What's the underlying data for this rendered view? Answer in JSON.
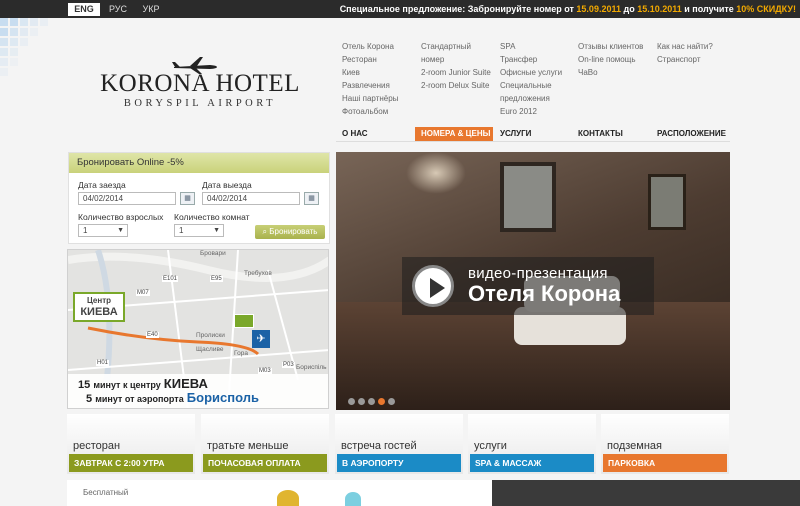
{
  "topbar": {
    "languages": [
      {
        "label": "ENG",
        "active": true
      },
      {
        "label": "РУС",
        "active": false
      },
      {
        "label": "УКР",
        "active": false
      }
    ],
    "offer": {
      "prefix": "Специальное предложение: Забронируйте номер от ",
      "date_from": "15.09.2011",
      "mid": " до ",
      "date_to": "15.10.2011",
      "suffix": " и получите ",
      "discount": "10% СКИДКУ!"
    }
  },
  "logo": {
    "title": "KORONA HOTEL",
    "subtitle": "BORYSPIL AIRPORT",
    "icon": "airplane-icon"
  },
  "nav": {
    "columns": [
      {
        "head": "О НАС",
        "active": false,
        "links": [
          "Отель Корона",
          "Ресторан",
          "Киев",
          "Развлечения",
          "Наші партнёры",
          "Фотоальбом"
        ]
      },
      {
        "head": "НОМЕРА & ЦЕНЫ",
        "active": true,
        "links": [
          "Стандартный номер",
          "2-room Junior Suite",
          "2-room Delux Suite"
        ]
      },
      {
        "head": "УСЛУГИ",
        "active": false,
        "links": [
          "SPA",
          "Трансфер",
          "Офисные услуги",
          "Специальные предложения",
          "Euro 2012"
        ]
      },
      {
        "head": "КОНТАКТЫ",
        "active": false,
        "links": [
          "Отзывы клиентов",
          "On-line помощь",
          "ЧаВо"
        ]
      },
      {
        "head": "РАСПОЛОЖЕНИЕ",
        "active": false,
        "links": [
          "Как нас найти?",
          "Странспорт"
        ]
      }
    ]
  },
  "booking": {
    "title": "Бронировать Online -5%",
    "checkin_label": "Дата заезда",
    "checkin_value": "04/02/2014",
    "checkout_label": "Дата выезда",
    "checkout_value": "04/02/2014",
    "adults_label": "Количество взрослых",
    "adults_value": "1",
    "rooms_label": "Количество комнат",
    "rooms_value": "1",
    "button": "Бронировать"
  },
  "map": {
    "center_label_1": "Центр",
    "center_label_2": "КИЕВА",
    "caption1_num": "15",
    "caption1_text": "минут к центру",
    "caption1_place": "КИЕВА",
    "caption2_num": "5",
    "caption2_text": "минут от аэропорта",
    "caption2_place": "Борисполь",
    "places": [
      "Бровари",
      "Требухов",
      "Пролиски",
      "Щасливе",
      "Гора",
      "Бориспіль"
    ],
    "roads": [
      "E101",
      "E95",
      "H01",
      "M07",
      "M03",
      "E40",
      "P03"
    ]
  },
  "video": {
    "line1": "видео-презентация",
    "line2": "Отеля Корона",
    "slides": 5,
    "active_slide": 4
  },
  "tiles": [
    {
      "title": "ресторан",
      "bar": "ЗАВТРАК С 2:00 УТРА",
      "color": "#8b9a1e"
    },
    {
      "title": "тратьте меньше",
      "bar": "ПОЧАСОВАЯ ОПЛАТА",
      "color": "#8b9a1e"
    },
    {
      "title": "встреча гостей",
      "bar": "В АЭРОПОРТУ",
      "color": "#1b8bc6"
    },
    {
      "title": "услуги",
      "bar": "SPA & МАССАЖ",
      "color": "#1b8bc6"
    },
    {
      "title": "подземная",
      "bar": "ПАРКОВКА",
      "color": "#e8772e"
    }
  ],
  "bottom": {
    "text": "Бесплатный"
  }
}
